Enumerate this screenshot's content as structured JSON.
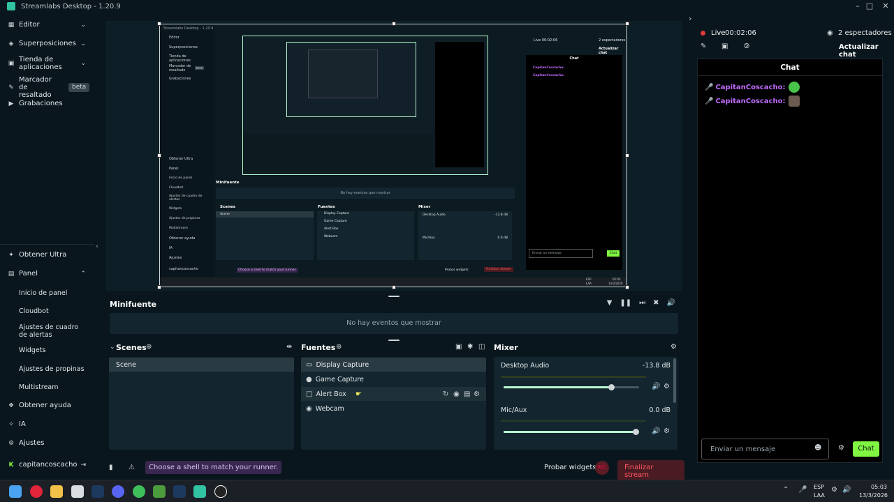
{
  "window": {
    "title": "Streamlabs Desktop - 1.20.9"
  },
  "sidebar": {
    "top_items": [
      {
        "label": "Editor",
        "icon": "editor-icon"
      },
      {
        "label": "Superposiciones",
        "icon": "overlays-icon"
      },
      {
        "label": "Tienda de aplicaciones",
        "icon": "app-store-icon"
      },
      {
        "label": "Marcador de resaltado",
        "icon": "highlighter-icon",
        "badge": "beta"
      },
      {
        "label": "Grabaciones",
        "icon": "recordings-icon"
      }
    ],
    "bottom_items": {
      "ultra": "Obtener Ultra",
      "panel": "Panel",
      "panel_sub": [
        "Inicio de panel",
        "Cloudbot",
        "Ajustes de cuadro de alertas",
        "Widgets",
        "Ajustes de propinas",
        "Multistream"
      ],
      "help": "Obtener ayuda",
      "ai": "IA",
      "settings": "Ajustes",
      "user": "capitancoscacho"
    }
  },
  "minifeed": {
    "title": "Minifuente",
    "empty": "No hay eventos que mostrar"
  },
  "scenes": {
    "title": "Scenes",
    "items": [
      "Scene"
    ]
  },
  "sources": {
    "title": "Fuentes",
    "items": [
      {
        "label": "Display Capture",
        "icon": "monitor-icon"
      },
      {
        "label": "Game Capture",
        "icon": "gamepad-icon"
      },
      {
        "label": "Alert Box",
        "icon": "alert-box-icon"
      },
      {
        "label": "Webcam",
        "icon": "webcam-icon"
      }
    ]
  },
  "mixer": {
    "title": "Mixer",
    "channels": [
      {
        "name": "Desktop Audio",
        "value": "-13.8 dB",
        "level": 0.8
      },
      {
        "name": "Mic/Aux",
        "value": "0.0 dB",
        "level": 1.0
      }
    ]
  },
  "bottombar": {
    "tip": "Choose a shell to match your runner.",
    "test_widgets": "Probar widgets",
    "rec": "REC",
    "end_stream": "Finalizar stream"
  },
  "live": {
    "status": "Live",
    "time": "00:02:06",
    "viewers": "2 espectadores",
    "refresh_chat": "Actualizar chat"
  },
  "chat": {
    "title": "Chat",
    "messages": [
      {
        "user": "CapitanCoscacho:"
      },
      {
        "user": "CapitanCoscacho:"
      }
    ],
    "placeholder": "Enviar un mensaje",
    "send": "Chat"
  },
  "preview_inner": {
    "title": "Streamlabs Desktop - 1.20.9",
    "minifeed": "Minifuente",
    "empty": "No hay eventos que mostrar",
    "scenes": "Scenes",
    "scene": "Scene",
    "sources": "Fuentes",
    "src": [
      "Display Capture",
      "Game Capture",
      "Alert Box",
      "Webcam"
    ],
    "mixer": "Mixer",
    "desktop_audio": "Desktop Audio",
    "desktop_db": "-13.8 dB",
    "mic": "Mic/Aux",
    "mic_db": "0.0 dB",
    "live": "Live 00:02:06",
    "viewers": "2 espectadores",
    "refresh": "Actualizar chat",
    "chat": "Chat",
    "user": "CapitanCoscacho:",
    "send_msg": "Enviar un mensaje",
    "send": "Chat",
    "tip": "Choose a shell to match your runner.",
    "test_widgets": "Probar widgets",
    "end_stream": "Finalizar stream",
    "clock_time": "05:03",
    "clock_date": "13/3/2026",
    "lang": "ESP",
    "lang2": "LAA",
    "nav": [
      "Editor",
      "Superposiciones",
      "Tienda de aplicaciones",
      "Marcador de resaltado",
      "Grabaciones"
    ],
    "nav_bottom": [
      "Obtener Ultra",
      "Panel",
      "Inicio de panel",
      "Cloudbot",
      "Ajustes de cuadro de alertas",
      "Widgets",
      "Ajustes de propinas",
      "Multistream",
      "Obtener ayuda",
      "IA",
      "Ajustes",
      "capitancoscacho"
    ],
    "beta": "beta"
  },
  "taskbar": {
    "lang": "ESP",
    "lang2": "LAA",
    "time": "05:03",
    "date": "13/3/2026"
  },
  "colors": {
    "accent": "#31c3a2",
    "live_red": "#e03a3a",
    "chat_user": "#c26bff",
    "send_green": "#80f542"
  }
}
